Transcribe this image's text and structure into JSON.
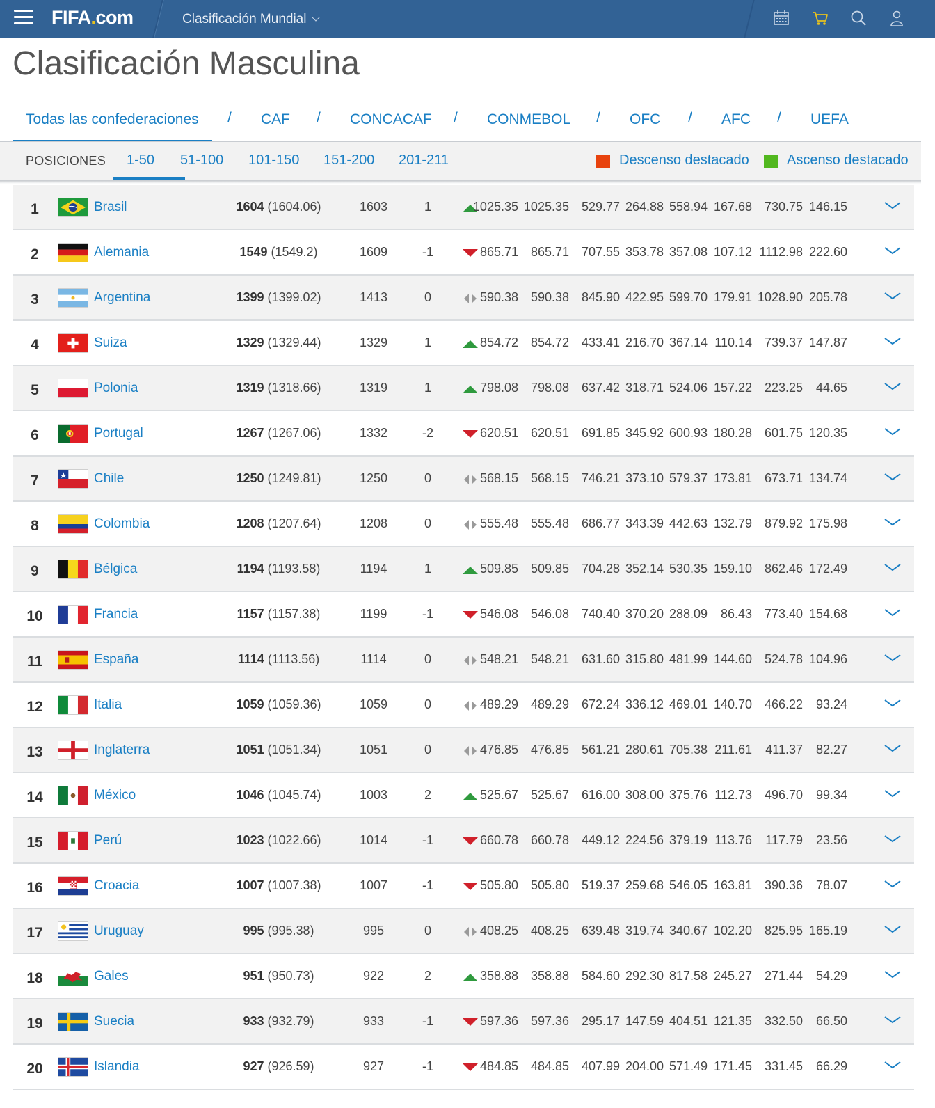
{
  "header": {
    "logo": "FIFA",
    "logo_dot": ".",
    "logo_suffix": "com",
    "section": "Clasificación Mundial"
  },
  "page_title": "Clasificación Masculina",
  "confederations": [
    "Todas las confederaciones",
    "CAF",
    "CONCACAF",
    "CONMEBOL",
    "OFC",
    "AFC",
    "UEFA"
  ],
  "confederation_separator": "/",
  "positions": {
    "label": "POSICIONES",
    "ranges": [
      "1-50",
      "51-100",
      "101-150",
      "151-200",
      "201-211"
    ],
    "active": "1-50"
  },
  "legend": {
    "down": "Descenso destacado",
    "up": "Ascenso destacado",
    "down_color": "#e8430e",
    "up_color": "#52b81f"
  },
  "colors": {
    "accent": "#1a7fc4",
    "topbar": "#326295",
    "trend_up": "#2f9a3e",
    "trend_down": "#d0202a",
    "trend_same": "#9a9a9a"
  },
  "rows": [
    {
      "rank": "1",
      "name": "Brasil",
      "pts": "1604",
      "pts_exact": "(1604.06)",
      "prev": "1603",
      "move": "1",
      "trend": "up",
      "vals": [
        "1025.35",
        "1025.35",
        "529.77",
        "264.88",
        "558.94",
        "167.68",
        "730.75",
        "146.15"
      ]
    },
    {
      "rank": "2",
      "name": "Alemania",
      "pts": "1549",
      "pts_exact": "(1549.2)",
      "prev": "1609",
      "move": "-1",
      "trend": "down",
      "vals": [
        "865.71",
        "865.71",
        "707.55",
        "353.78",
        "357.08",
        "107.12",
        "1112.98",
        "222.60"
      ]
    },
    {
      "rank": "3",
      "name": "Argentina",
      "pts": "1399",
      "pts_exact": "(1399.02)",
      "prev": "1413",
      "move": "0",
      "trend": "same",
      "vals": [
        "590.38",
        "590.38",
        "845.90",
        "422.95",
        "599.70",
        "179.91",
        "1028.90",
        "205.78"
      ]
    },
    {
      "rank": "4",
      "name": "Suiza",
      "pts": "1329",
      "pts_exact": "(1329.44)",
      "prev": "1329",
      "move": "1",
      "trend": "up",
      "vals": [
        "854.72",
        "854.72",
        "433.41",
        "216.70",
        "367.14",
        "110.14",
        "739.37",
        "147.87"
      ]
    },
    {
      "rank": "5",
      "name": "Polonia",
      "pts": "1319",
      "pts_exact": "(1318.66)",
      "prev": "1319",
      "move": "1",
      "trend": "up",
      "vals": [
        "798.08",
        "798.08",
        "637.42",
        "318.71",
        "524.06",
        "157.22",
        "223.25",
        "44.65"
      ]
    },
    {
      "rank": "6",
      "name": "Portugal",
      "pts": "1267",
      "pts_exact": "(1267.06)",
      "prev": "1332",
      "move": "-2",
      "trend": "down",
      "vals": [
        "620.51",
        "620.51",
        "691.85",
        "345.92",
        "600.93",
        "180.28",
        "601.75",
        "120.35"
      ]
    },
    {
      "rank": "7",
      "name": "Chile",
      "pts": "1250",
      "pts_exact": "(1249.81)",
      "prev": "1250",
      "move": "0",
      "trend": "same",
      "vals": [
        "568.15",
        "568.15",
        "746.21",
        "373.10",
        "579.37",
        "173.81",
        "673.71",
        "134.74"
      ]
    },
    {
      "rank": "8",
      "name": "Colombia",
      "pts": "1208",
      "pts_exact": "(1207.64)",
      "prev": "1208",
      "move": "0",
      "trend": "same",
      "vals": [
        "555.48",
        "555.48",
        "686.77",
        "343.39",
        "442.63",
        "132.79",
        "879.92",
        "175.98"
      ]
    },
    {
      "rank": "9",
      "name": "Bélgica",
      "pts": "1194",
      "pts_exact": "(1193.58)",
      "prev": "1194",
      "move": "1",
      "trend": "up",
      "vals": [
        "509.85",
        "509.85",
        "704.28",
        "352.14",
        "530.35",
        "159.10",
        "862.46",
        "172.49"
      ]
    },
    {
      "rank": "10",
      "name": "Francia",
      "pts": "1157",
      "pts_exact": "(1157.38)",
      "prev": "1199",
      "move": "-1",
      "trend": "down",
      "vals": [
        "546.08",
        "546.08",
        "740.40",
        "370.20",
        "288.09",
        "86.43",
        "773.40",
        "154.68"
      ]
    },
    {
      "rank": "11",
      "name": "España",
      "pts": "1114",
      "pts_exact": "(1113.56)",
      "prev": "1114",
      "move": "0",
      "trend": "same",
      "vals": [
        "548.21",
        "548.21",
        "631.60",
        "315.80",
        "481.99",
        "144.60",
        "524.78",
        "104.96"
      ]
    },
    {
      "rank": "12",
      "name": "Italia",
      "pts": "1059",
      "pts_exact": "(1059.36)",
      "prev": "1059",
      "move": "0",
      "trend": "same",
      "vals": [
        "489.29",
        "489.29",
        "672.24",
        "336.12",
        "469.01",
        "140.70",
        "466.22",
        "93.24"
      ]
    },
    {
      "rank": "13",
      "name": "Inglaterra",
      "pts": "1051",
      "pts_exact": "(1051.34)",
      "prev": "1051",
      "move": "0",
      "trend": "same",
      "vals": [
        "476.85",
        "476.85",
        "561.21",
        "280.61",
        "705.38",
        "211.61",
        "411.37",
        "82.27"
      ]
    },
    {
      "rank": "14",
      "name": "México",
      "pts": "1046",
      "pts_exact": "(1045.74)",
      "prev": "1003",
      "move": "2",
      "trend": "up",
      "vals": [
        "525.67",
        "525.67",
        "616.00",
        "308.00",
        "375.76",
        "112.73",
        "496.70",
        "99.34"
      ]
    },
    {
      "rank": "15",
      "name": "Perú",
      "pts": "1023",
      "pts_exact": "(1022.66)",
      "prev": "1014",
      "move": "-1",
      "trend": "down",
      "vals": [
        "660.78",
        "660.78",
        "449.12",
        "224.56",
        "379.19",
        "113.76",
        "117.79",
        "23.56"
      ]
    },
    {
      "rank": "16",
      "name": "Croacia",
      "pts": "1007",
      "pts_exact": "(1007.38)",
      "prev": "1007",
      "move": "-1",
      "trend": "down",
      "vals": [
        "505.80",
        "505.80",
        "519.37",
        "259.68",
        "546.05",
        "163.81",
        "390.36",
        "78.07"
      ]
    },
    {
      "rank": "17",
      "name": "Uruguay",
      "pts": "995",
      "pts_exact": "(995.38)",
      "prev": "995",
      "move": "0",
      "trend": "same",
      "vals": [
        "408.25",
        "408.25",
        "639.48",
        "319.74",
        "340.67",
        "102.20",
        "825.95",
        "165.19"
      ]
    },
    {
      "rank": "18",
      "name": "Gales",
      "pts": "951",
      "pts_exact": "(950.73)",
      "prev": "922",
      "move": "2",
      "trend": "up",
      "vals": [
        "358.88",
        "358.88",
        "584.60",
        "292.30",
        "817.58",
        "245.27",
        "271.44",
        "54.29"
      ]
    },
    {
      "rank": "19",
      "name": "Suecia",
      "pts": "933",
      "pts_exact": "(932.79)",
      "prev": "933",
      "move": "-1",
      "trend": "down",
      "vals": [
        "597.36",
        "597.36",
        "295.17",
        "147.59",
        "404.51",
        "121.35",
        "332.50",
        "66.50"
      ]
    },
    {
      "rank": "20",
      "name": "Islandia",
      "pts": "927",
      "pts_exact": "(926.59)",
      "prev": "927",
      "move": "-1",
      "trend": "down",
      "vals": [
        "484.85",
        "484.85",
        "407.99",
        "204.00",
        "571.49",
        "171.45",
        "331.45",
        "66.29"
      ]
    }
  ]
}
